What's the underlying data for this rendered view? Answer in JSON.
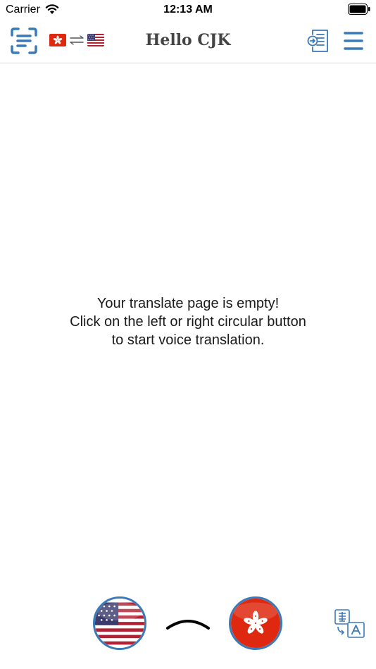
{
  "status_bar": {
    "carrier": "Carrier",
    "time": "12:13 AM",
    "wifi_icon": "wifi-icon",
    "battery_icon": "battery-full-icon"
  },
  "nav_bar": {
    "title": "Hello CJK",
    "scan_icon": "text-scan-icon",
    "source_flag": "hong-kong-flag-icon",
    "swap_icon": "swap-arrows-icon",
    "target_flag": "us-flag-icon",
    "document_icon": "document-import-icon",
    "menu_icon": "hamburger-menu-icon"
  },
  "empty_state": {
    "line1": "Your translate page is empty!",
    "line2": "Click on the left or right circular button",
    "line3": "to start voice translation."
  },
  "bottom_bar": {
    "left_voice_icon": "us-flag-icon",
    "right_voice_icon": "hong-kong-flag-icon",
    "expand_icon": "chevron-up-icon",
    "translate_icon": "character-translate-icon"
  },
  "colors": {
    "accent": "#3b7ab8",
    "hk_red": "#de2910",
    "us_red": "#b22234",
    "us_blue": "#3c3b6e",
    "title_gray": "#444444"
  }
}
